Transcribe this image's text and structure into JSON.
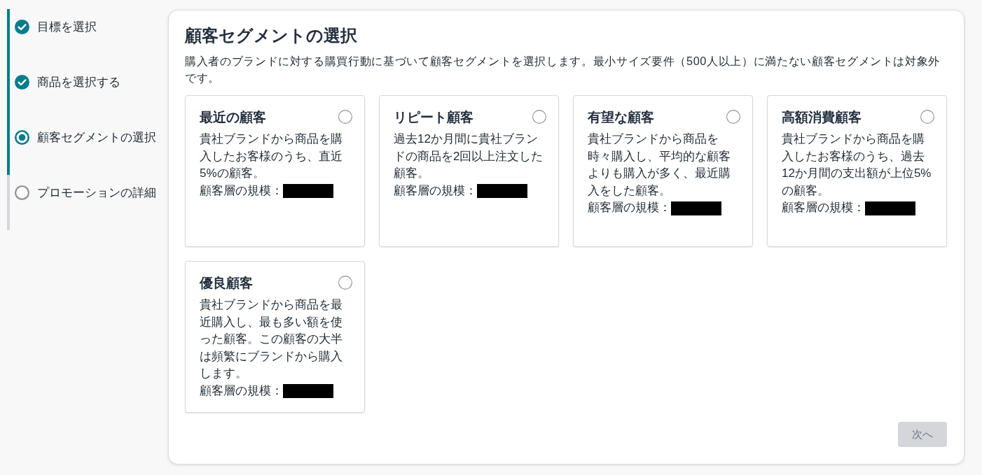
{
  "steps": [
    {
      "label": "目標を選択",
      "completed": true,
      "selected": false
    },
    {
      "label": "商品を選択する",
      "completed": true,
      "selected": false
    },
    {
      "label": "顧客セグメントの選択",
      "completed": false,
      "selected": true
    },
    {
      "label": "プロモーションの詳細",
      "completed": false,
      "selected": false
    }
  ],
  "panel": {
    "title": "顧客セグメントの選択",
    "description": "購入者のブランドに対する購買行動に基づいて顧客セグメントを選択します。最小サイズ要件（500人以上）に満たない顧客セグメントは対象外です。"
  },
  "segments": [
    {
      "title": "最近の顧客",
      "selected": false,
      "description": "貴社ブランドから商品を購入したお客様のうち、直近5%の顧客。",
      "size_label": "顧客層の規模：",
      "size_redacted": true
    },
    {
      "title": "リピート顧客",
      "selected": false,
      "description": "過去12か月間に貴社ブランドの商品を2回以上注文した顧客。",
      "size_label": "顧客層の規模：",
      "size_redacted": true
    },
    {
      "title": "有望な顧客",
      "selected": false,
      "description": "貴社ブランドから商品を時々購入し、平均的な顧客よりも購入が多く、最近購入をした顧客。",
      "size_label": "顧客層の規模：",
      "size_redacted": true
    },
    {
      "title": "高額消費顧客",
      "selected": false,
      "description": "貴社ブランドから商品を購入したお客様のうち、過去12か月間の支出額が上位5%の顧客。",
      "size_label": "顧客層の規模：",
      "size_redacted": true
    },
    {
      "title": "優良顧客",
      "selected": false,
      "description": "貴社ブランドから商品を最近購入し、最も多い額を使った顧客。この顧客の大半は頻繁にブランドから購入します。",
      "size_label": "顧客層の規模：",
      "size_redacted": true
    }
  ],
  "next_button": {
    "label": "次へ",
    "disabled": true
  }
}
